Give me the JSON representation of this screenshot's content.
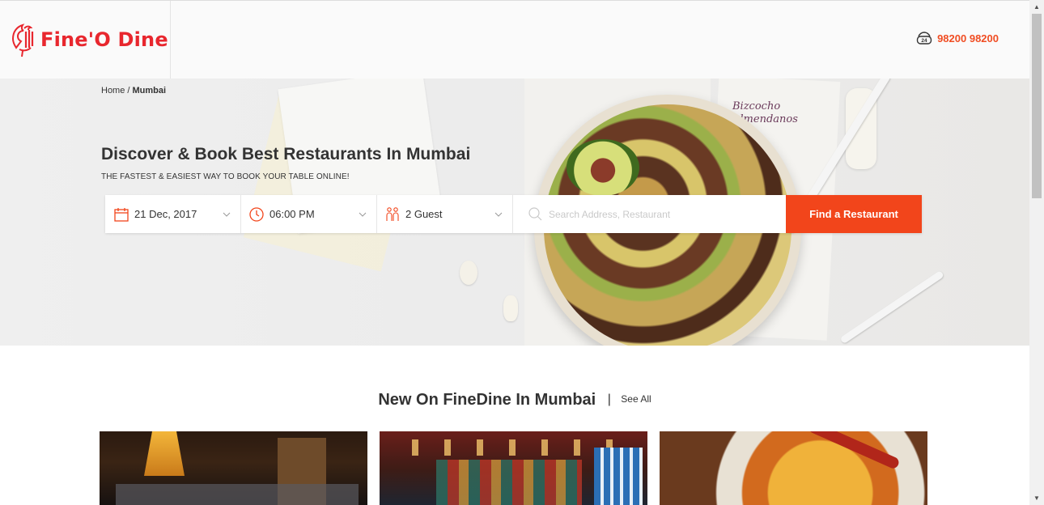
{
  "brand": {
    "name": "Fine'O Dine"
  },
  "header": {
    "phone": "98200 98200",
    "phone_icon": "24h-phone-icon"
  },
  "breadcrumb": {
    "home": "Home",
    "separator": " / ",
    "current": "Mumbai"
  },
  "hero": {
    "title": "Discover & Book Best Restaurants In Mumbai",
    "subtitle": "THE FASTEST & EASIEST WAY TO BOOK YOUR TABLE ONLINE!",
    "handwriting": [
      "Bizcocho",
      "Almendanos"
    ]
  },
  "search": {
    "date": "21 Dec, 2017",
    "time": "06:00 PM",
    "guests": "2 Guest",
    "placeholder": "Search Address, Restaurant",
    "button": "Find a Restaurant"
  },
  "section": {
    "title": "New On FineDine In Mumbai",
    "separator": "|",
    "see_all": "See All"
  },
  "colors": {
    "brand_red": "#e8272e",
    "accent_orange": "#f2451b"
  }
}
